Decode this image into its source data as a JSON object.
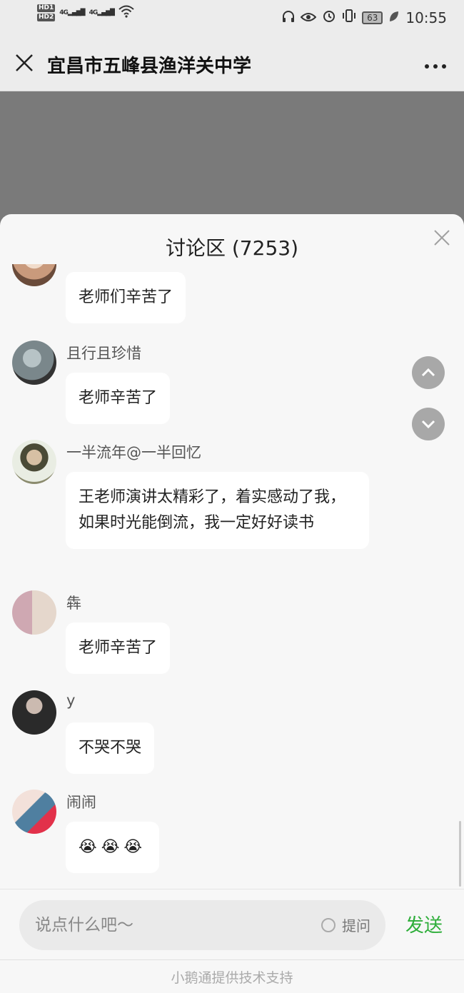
{
  "status_bar": {
    "hd1": "HD1",
    "hd2": "HD2",
    "net1": "4G",
    "net2": "4G",
    "battery": "63",
    "time": "10:55",
    "icons": [
      "headphone-icon",
      "eye-icon",
      "alarm-icon",
      "vibrate-icon",
      "battery-icon",
      "leaf-icon",
      "wifi-icon",
      "signal-icon"
    ]
  },
  "nav": {
    "close_icon": "×",
    "title": "宜昌市五峰县渔洋关中学",
    "more_icon": "···"
  },
  "panel": {
    "title": "讨论区 (7253)",
    "close_icon": "×"
  },
  "messages": [
    {
      "name": "",
      "text": "老师们辛苦了",
      "avatar_color": "#d9b9a3"
    },
    {
      "name": "且行且珍惜",
      "text": "老师辛苦了",
      "avatar_color": "#6f7b80"
    },
    {
      "name": "一半流年@一半回忆",
      "text": "王老师演讲太精彩了，着实感动了我，如果时光能倒流，我一定好好读书",
      "avatar_color": "#8b8b6e"
    },
    {
      "name": "犇",
      "text": "老师辛苦了",
      "avatar_color": "#b4a194"
    },
    {
      "name": "y",
      "text": "不哭不哭",
      "avatar_color": "#3b3b3b"
    },
    {
      "name": "闹闹",
      "text": "😭😭😭",
      "avatar_color": "#c7a6a4"
    }
  ],
  "scroll": {
    "up_icon": "︿",
    "down_icon": "﹀"
  },
  "input": {
    "placeholder": "说点什么吧～",
    "ask_label": "提问",
    "send_label": "发送"
  },
  "footer": {
    "text": "小鹅通提供技术支持"
  },
  "colors": {
    "accent_green": "#2eae3a",
    "video_gray": "#7a7a7a"
  }
}
